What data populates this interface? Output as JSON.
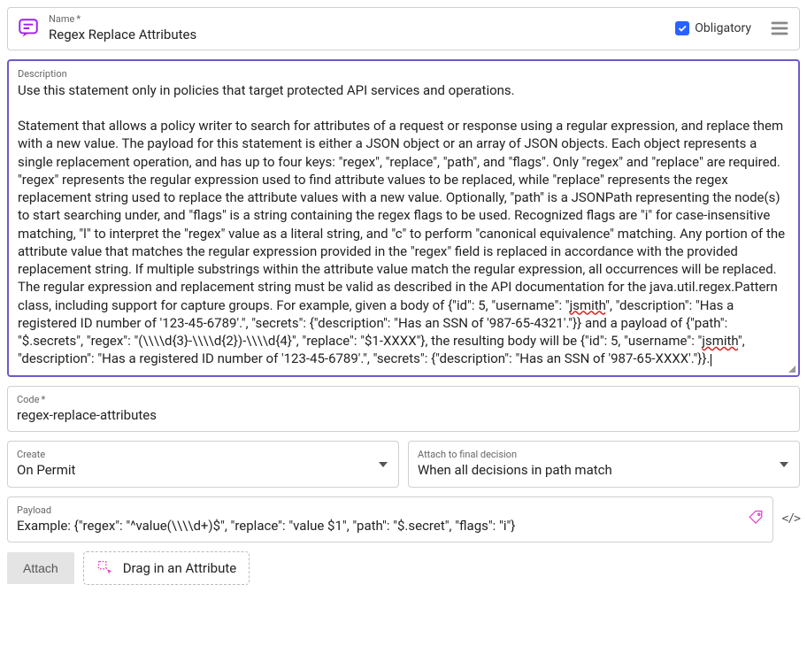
{
  "name": {
    "label": "Name",
    "required_mark": "*",
    "value": "Regex Replace Attributes",
    "obligatory_label": "Obligatory"
  },
  "description": {
    "label": "Description",
    "para1": "Use this statement only in policies that target protected API services and operations.",
    "para2a": "Statement that allows a policy writer to search for attributes of a request or response using a regular expression, and replace them with a new value. The payload for this statement is either a JSON object or an array of JSON objects. Each object represents a single replacement operation, and has up to four keys: \"regex\", \"replace\", \"path\", and \"flags\". Only \"regex\" and \"replace\" are required. \"regex\" represents the regular expression used to find attribute values to be replaced, while \"replace\" represents the regex replacement string used to replace the attribute values with a new value. Optionally, \"path\" is a JSONPath representing the node(s) to start searching under, and \"flags\" is a string containing the regex flags to be used. Recognized flags are \"i\" for case-insensitive matching, \"l\" to interpret the \"regex\" value as a literal string, and \"c\" to perform \"canonical equivalence\" matching. Any portion of the attribute value that matches the regular expression provided in the \"regex\" field is replaced in accordance with the provided replacement string. If multiple substrings within the attribute value match the regular expression, all occurrences will be replaced. The regular expression and replacement string must be valid as described in the API documentation for the java.util.regex.Pattern class, including support for capture groups. For example, given a body of {\"id\": 5, \"username\": \"",
    "jsmith1": "jsmith",
    "para2b": "\", \"description\": \"Has a registered ID number of '123-45-6789'.\", \"secrets\": {\"description\": \"Has an SSN of '987-65-4321'.\"}} and a payload of {\"path\": \"$.secrets\", \"regex\": \"(\\\\\\\\d{3}-\\\\\\\\d{2})-\\\\\\\\d{4}\", \"replace\": \"$1-XXXX\"}, the resulting body will be {\"id\": 5, \"username\": \"",
    "jsmith2": "jsmith",
    "para2c": "\", \"description\": \"Has a registered ID number of '123-45-6789'.\", \"secrets\": {\"description\": \"Has an SSN of '987-65-XXXX'.\"}}."
  },
  "code": {
    "label": "Code",
    "required_mark": "*",
    "value": "regex-replace-attributes"
  },
  "create": {
    "label": "Create",
    "value": "On Permit"
  },
  "attach_decision": {
    "label": "Attach to final decision",
    "value": "When all decisions in path match"
  },
  "payload": {
    "label": "Payload",
    "value": "Example: {\"regex\": \"^value(\\\\\\\\d+)$\", \"replace\": \"value $1\", \"path\": \"$.secret\", \"flags\": \"i\"}"
  },
  "code_toggle": "</>",
  "attach_button": "Attach",
  "drag_label": "Drag in an Attribute"
}
